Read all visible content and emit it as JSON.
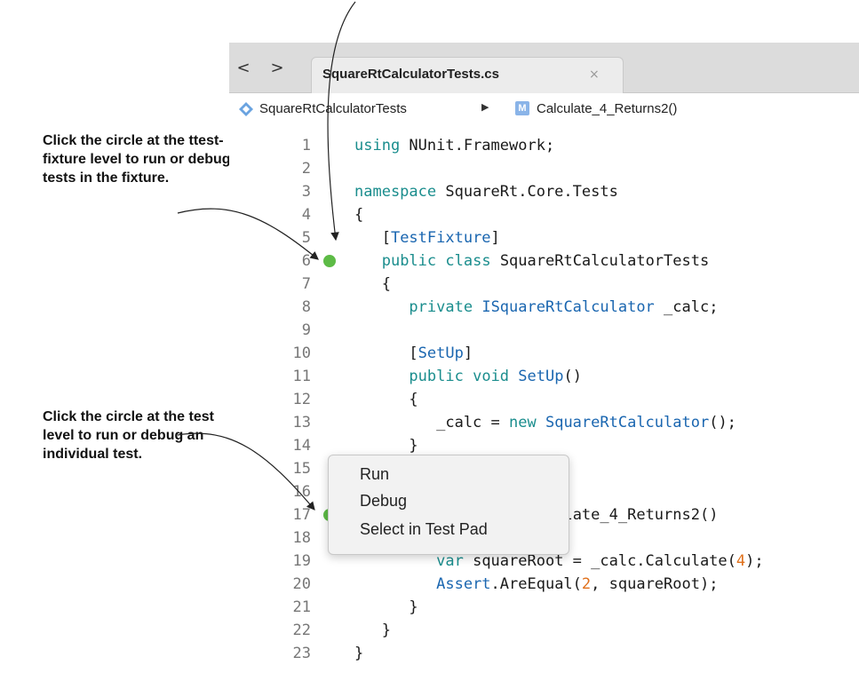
{
  "callouts": {
    "fixture": "Click the circle at the ttest-fixture level to run or debug all tests in the fixture.",
    "test": "Click the circle at the test level to run or debug an individual test."
  },
  "tabbar": {
    "back_glyph": "<",
    "forward_glyph": ">",
    "tab_title": "SquareRtCalculatorTests.cs",
    "tab_close_glyph": "×"
  },
  "breadcrumb": {
    "class_name": "SquareRtCalculatorTests",
    "separator": "▶",
    "method_icon_letter": "M",
    "method_name": "Calculate_4_Returns2()"
  },
  "code_lines": [
    {
      "num": "1",
      "text": "using NUnit.Framework;"
    },
    {
      "num": "2",
      "text": ""
    },
    {
      "num": "3",
      "text": "namespace SquareRt.Core.Tests"
    },
    {
      "num": "4",
      "text": "{"
    },
    {
      "num": "5",
      "text": "   [TestFixture]"
    },
    {
      "num": "6",
      "text": "   public class SquareRtCalculatorTests"
    },
    {
      "num": "7",
      "text": "   {"
    },
    {
      "num": "8",
      "text": "      private ISquareRtCalculator _calc;"
    },
    {
      "num": "9",
      "text": ""
    },
    {
      "num": "10",
      "text": "      [SetUp]"
    },
    {
      "num": "11",
      "text": "      public void SetUp()"
    },
    {
      "num": "12",
      "text": "      {"
    },
    {
      "num": "13",
      "text": "         _calc = new SquareRtCalculator();"
    },
    {
      "num": "14",
      "text": "      }"
    },
    {
      "num": "15",
      "text": ""
    },
    {
      "num": "16",
      "text": "      [Test]"
    },
    {
      "num": "17",
      "text": "      public void Calculate_4_Returns2()"
    },
    {
      "num": "18",
      "text": "      {"
    },
    {
      "num": "19",
      "text": "         var squareRoot = _calc.Calculate(4);"
    },
    {
      "num": "20",
      "text": "         Assert.AreEqual(2, squareRoot);"
    },
    {
      "num": "21",
      "text": "      }"
    },
    {
      "num": "22",
      "text": "   }"
    },
    {
      "num": "23",
      "text": "}"
    }
  ],
  "context_menu": {
    "items": [
      "Run",
      "Debug",
      "Select in Test Pad"
    ]
  },
  "colors": {
    "keyword": "#1a8d8d",
    "type": "#1a66b0",
    "number": "#e0701b",
    "test_pass": "#5dbb46"
  },
  "icons": {
    "class_icon": "class-diamond-icon",
    "method_icon": "method-icon",
    "fixture_status": "test-pass-circle-icon",
    "test_status": "test-pass-circle-icon"
  }
}
